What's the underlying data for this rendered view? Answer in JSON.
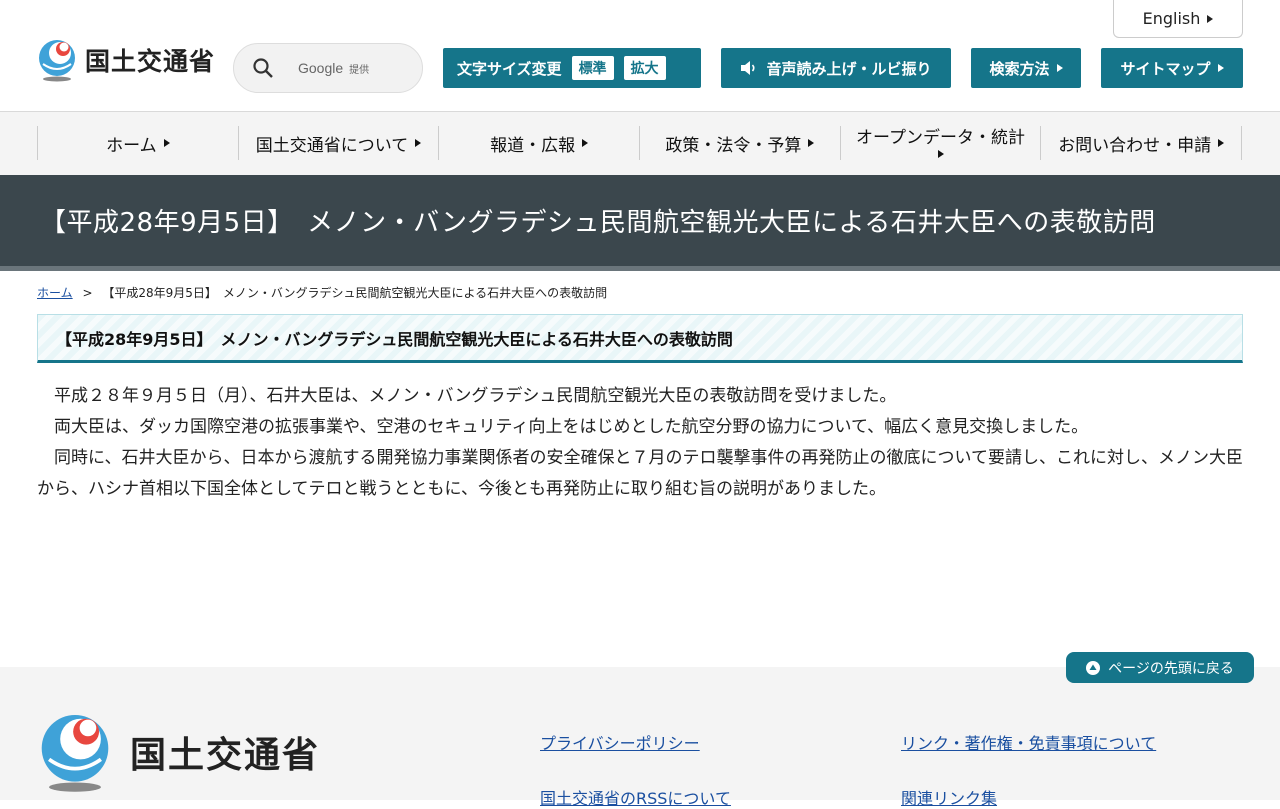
{
  "header": {
    "logo_text": "国土交通省",
    "search": {
      "google_label": "Google",
      "provided_label": "提供"
    },
    "english_label": "English",
    "font_size": {
      "label": "文字サイズ変更",
      "standard": "標準",
      "large": "拡大"
    },
    "voice_label": "音声読み上げ・ルビ振り",
    "search_method_label": "検索方法",
    "sitemap_label": "サイトマップ"
  },
  "nav": {
    "items": [
      {
        "label": "ホーム"
      },
      {
        "label": "国土交通省について"
      },
      {
        "label": "報道・広報"
      },
      {
        "label": "政策・法令・予算"
      },
      {
        "label": "オープンデータ・統計"
      },
      {
        "label": "お問い合わせ・申請"
      }
    ]
  },
  "banner": {
    "title": "【平成28年9月5日】　メノン・バングラデシュ民間航空観光大臣による石井大臣への表敬訪問"
  },
  "breadcrumb": {
    "home": "ホーム",
    "separator": ">",
    "current": "【平成28年9月5日】　メノン・バングラデシュ民間航空観光大臣による石井大臣への表敬訪問"
  },
  "section_title": "【平成28年9月5日】　メノン・バングラデシュ民間航空観光大臣による石井大臣への表敬訪問",
  "content": {
    "paragraphs": [
      "平成２８年９月５日（月）、石井大臣は、メノン・バングラデシュ民間航空観光大臣の表敬訪問を受けました。",
      "両大臣は、ダッカ国際空港の拡張事業や、空港のセキュリティ向上をはじめとした航空分野の協力について、幅広く意見交換しました。",
      "同時に、石井大臣から、日本から渡航する開発協力事業関係者の安全確保と７月のテロ襲撃事件の再発防止の徹底について要請し、これに対し、メノン大臣から、ハシナ首相以下国全体としてテロと戦うとともに、今後とも再発防止に取り組む旨の説明がありました。"
    ]
  },
  "page_top_label": "ページの先頭に戻る",
  "footer": {
    "logo_text": "国土交通省",
    "links": {
      "privacy": "プライバシーポリシー",
      "rss": "国土交通省のRSSについて",
      "copyright": "リンク・著作権・免責事項について",
      "related": "関連リンク集"
    }
  },
  "colors": {
    "accent": "#15758a",
    "banner": "#3b474d",
    "link": "#1a4fa0"
  }
}
